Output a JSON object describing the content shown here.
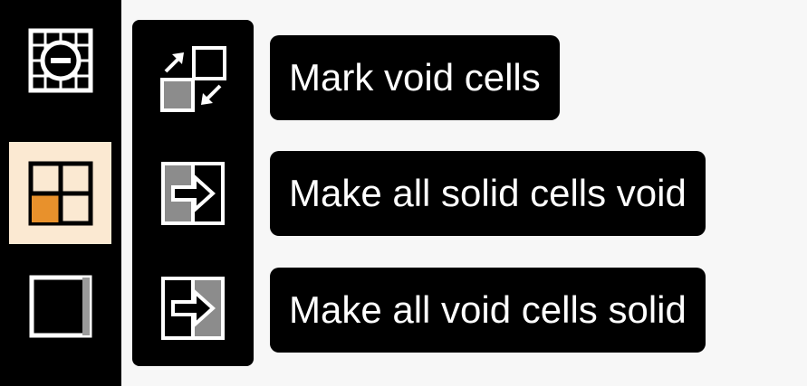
{
  "sidebar": {
    "tools": [
      {
        "icon": "void-grid-icon",
        "active": false
      },
      {
        "icon": "cell-grid-icon",
        "active": true
      },
      {
        "icon": "solid-square-icon",
        "active": false
      }
    ]
  },
  "flyout": {
    "items": [
      {
        "icon": "swap-cells-icon",
        "tooltip": "Mark void cells"
      },
      {
        "icon": "solid-to-void-icon",
        "tooltip": "Make all solid cells void"
      },
      {
        "icon": "void-to-solid-icon",
        "tooltip": "Make all void cells solid"
      }
    ]
  },
  "colors": {
    "accent": "#e8912c",
    "active_bg": "#fbe9d2",
    "cell_fill": "#8c8c8c"
  }
}
